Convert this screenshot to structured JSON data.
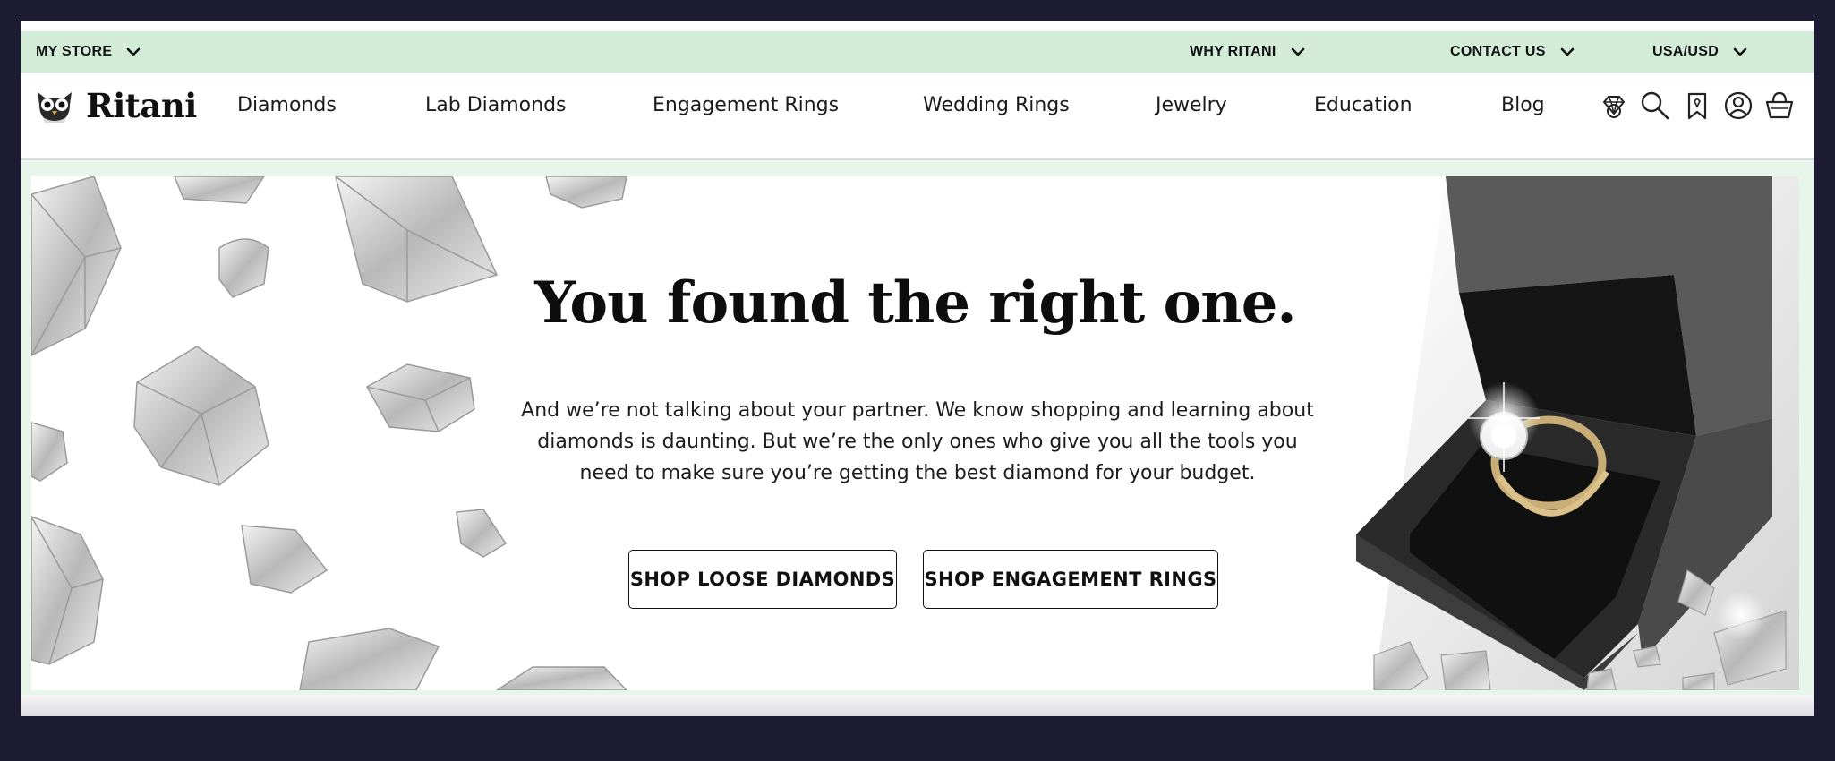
{
  "topbar": {
    "my_store": "MY STORE",
    "why_ritani": "WHY RITANI",
    "contact_us": "CONTACT US",
    "locale": "USA/USD"
  },
  "brand": {
    "name": "Ritani",
    "logo_icon": "owl-mascot-icon"
  },
  "nav": {
    "items": [
      "Diamonds",
      "Lab Diamonds",
      "Engagement Rings",
      "Wedding Rings",
      "Jewelry",
      "Education",
      "Blog"
    ],
    "icons": [
      "ring-icon",
      "search-icon",
      "bookmark-icon",
      "account-icon",
      "cart-icon"
    ]
  },
  "hero": {
    "headline": "You found the right one.",
    "body": "And we’re not talking about your partner. We know shopping and learning about diamonds is daunting. But we’re the only ones who give you all the tools you need to make sure you’re getting the best diamond for your budget.",
    "cta_primary": "SHOP LOOSE DIAMONDS",
    "cta_secondary": "SHOP ENGAGEMENT RINGS"
  },
  "colors": {
    "page_background": "#1c1b33",
    "topbar_background": "#d2ecd8",
    "hero_band": "#e8f5ea",
    "text": "#111111"
  }
}
